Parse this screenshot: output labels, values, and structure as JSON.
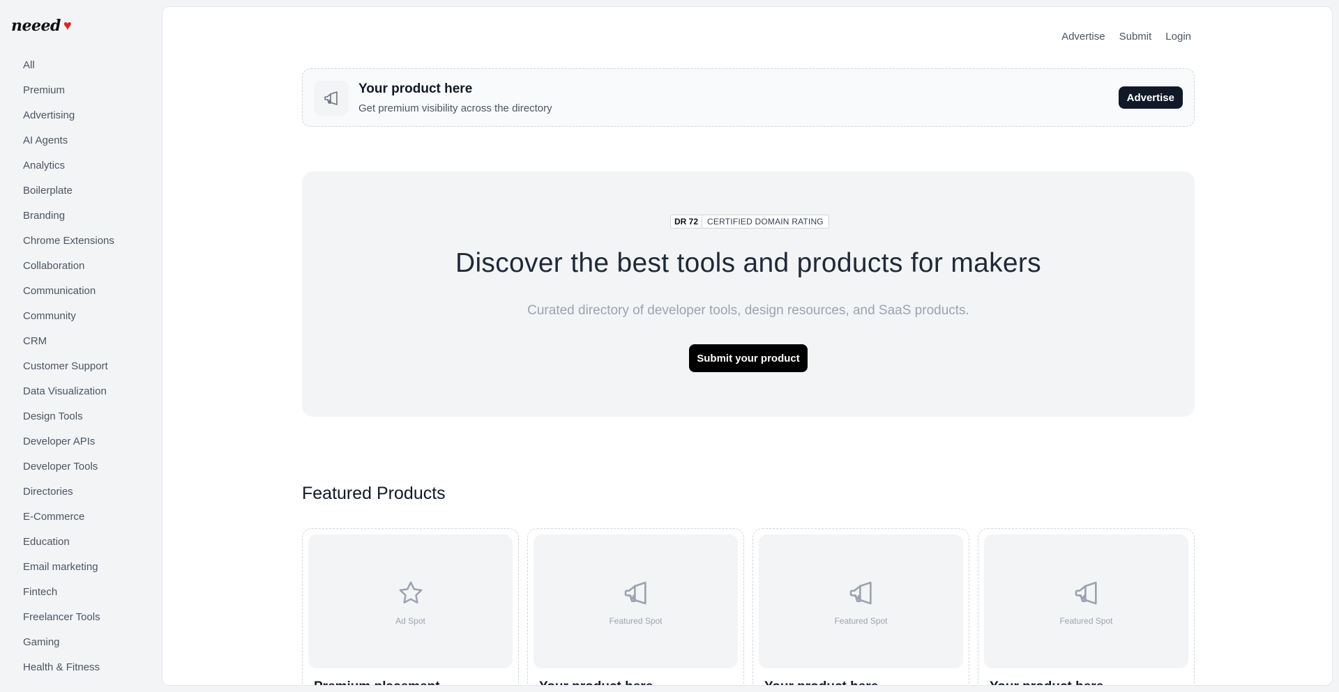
{
  "logo": {
    "text": "neeed",
    "heart": "♥"
  },
  "sidebar": {
    "items": [
      "All",
      "Premium",
      "Advertising",
      "AI Agents",
      "Analytics",
      "Boilerplate",
      "Branding",
      "Chrome Extensions",
      "Collaboration",
      "Communication",
      "Community",
      "CRM",
      "Customer Support",
      "Data Visualization",
      "Design Tools",
      "Developer APIs",
      "Developer Tools",
      "Directories",
      "E-Commerce",
      "Education",
      "Email marketing",
      "Fintech",
      "Freelancer Tools",
      "Gaming",
      "Health & Fitness"
    ]
  },
  "topnav": {
    "advertise": "Advertise",
    "submit": "Submit",
    "login": "Login"
  },
  "ad_banner": {
    "icon": "megaphone-icon",
    "title": "Your product here",
    "subtitle": "Get premium visibility across the directory",
    "button": "Advertise"
  },
  "hero": {
    "badge_dr": "DR 72",
    "badge_text": "CERTIFIED DOMAIN RATING",
    "title": "Discover the best tools and products for makers",
    "subtitle": "Curated directory of developer tools, design resources, and SaaS products.",
    "button": "Submit your product"
  },
  "featured": {
    "title": "Featured Products",
    "cards": [
      {
        "icon": "star-icon",
        "spot": "Ad Spot",
        "title": "Premium placement"
      },
      {
        "icon": "megaphone-icon",
        "spot": "Featured Spot",
        "title": "Your product here"
      },
      {
        "icon": "megaphone-icon",
        "spot": "Featured Spot",
        "title": "Your product here"
      },
      {
        "icon": "megaphone-icon",
        "spot": "Featured Spot",
        "title": "Your product here"
      }
    ]
  },
  "colors": {
    "accent": "#111827",
    "heart": "#dc2626",
    "background": "#f3f4f6"
  }
}
